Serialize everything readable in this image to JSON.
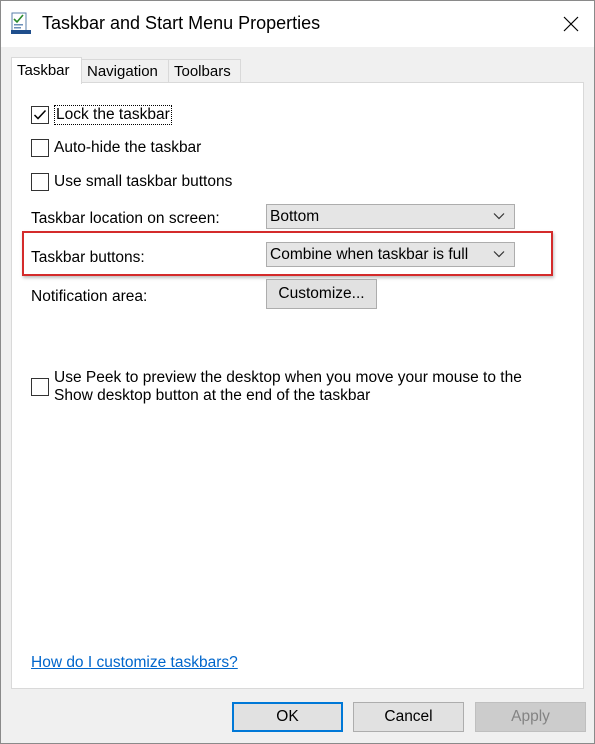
{
  "window": {
    "title": "Taskbar and Start Menu Properties"
  },
  "tabs": [
    {
      "label": "Taskbar",
      "active": true
    },
    {
      "label": "Navigation",
      "active": false
    },
    {
      "label": "Toolbars",
      "active": false
    }
  ],
  "options": {
    "lock": {
      "label": "Lock the taskbar",
      "checked": true
    },
    "autohide": {
      "label": "Auto-hide the taskbar",
      "checked": false
    },
    "small_buttons": {
      "label": "Use small taskbar buttons",
      "checked": false
    },
    "peek": {
      "line1": "Use Peek to preview the desktop when you move your mouse to the",
      "line2": "Show desktop button at the end of the taskbar",
      "checked": false
    }
  },
  "location": {
    "label": "Taskbar location on screen:",
    "value": "Bottom"
  },
  "buttons_combine": {
    "label": "Taskbar buttons:",
    "value": "Combine when taskbar is full"
  },
  "notification": {
    "label": "Notification area:",
    "button": "Customize..."
  },
  "help_link": "How do I customize taskbars?",
  "footer": {
    "ok": "OK",
    "cancel": "Cancel",
    "apply": "Apply"
  },
  "colors": {
    "highlight": "#d42b2b",
    "link": "#0066cc",
    "focus": "#0078d7"
  }
}
